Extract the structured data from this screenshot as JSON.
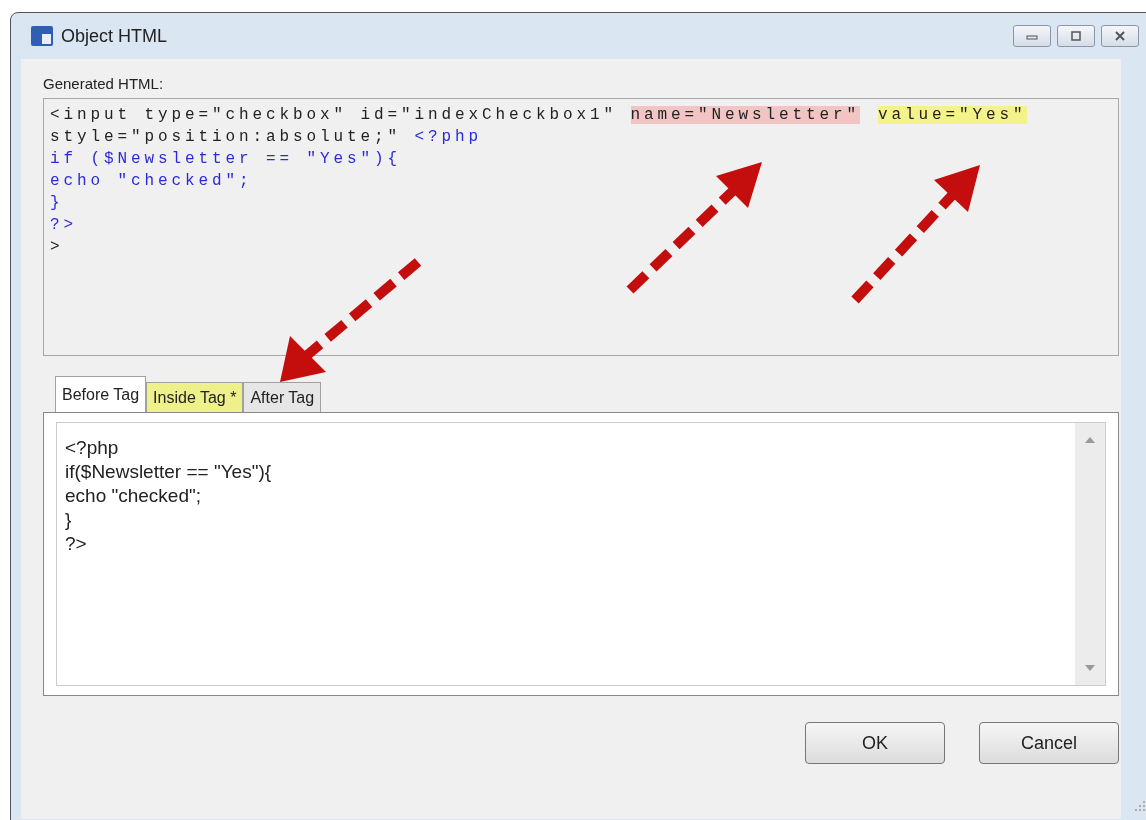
{
  "window": {
    "title": "Object HTML"
  },
  "generated_html": {
    "label": "Generated HTML:",
    "lines": [
      [
        {
          "kind": "plain",
          "text": "<input type=\"checkbox\" id=\"indexCheckbox1\" "
        },
        {
          "kind": "highlight",
          "text": "name=\"Newsletter\"",
          "color": "#f2c4c4"
        },
        {
          "kind": "highlight",
          "text": "value=\"Yes\"",
          "color": "#f4f28a"
        }
      ],
      [
        {
          "kind": "plain",
          "text": "style=\"position:absolute;\" "
        },
        {
          "kind": "php",
          "text": "<?php"
        }
      ],
      [
        {
          "kind": "php",
          "text": "if ($Newsletter == \"Yes\"){"
        }
      ],
      [
        {
          "kind": "php",
          "text": "echo \"checked\";"
        }
      ],
      [
        {
          "kind": "php",
          "text": "}"
        }
      ],
      [
        {
          "kind": "php",
          "text": "?>"
        }
      ],
      [
        {
          "kind": "plain",
          "text": ">"
        }
      ]
    ]
  },
  "tabs": [
    {
      "label": "Before Tag",
      "selected": true
    },
    {
      "label": "Inside Tag *",
      "selected": false,
      "color": "#eef08a"
    },
    {
      "label": "After Tag",
      "selected": false
    }
  ],
  "editor": {
    "lines": [
      "<?php",
      "if($Newsletter == \"Yes\"){",
      "echo \"checked\";",
      "}",
      "?>"
    ]
  },
  "buttons": [
    "OK",
    "Cancel"
  ]
}
